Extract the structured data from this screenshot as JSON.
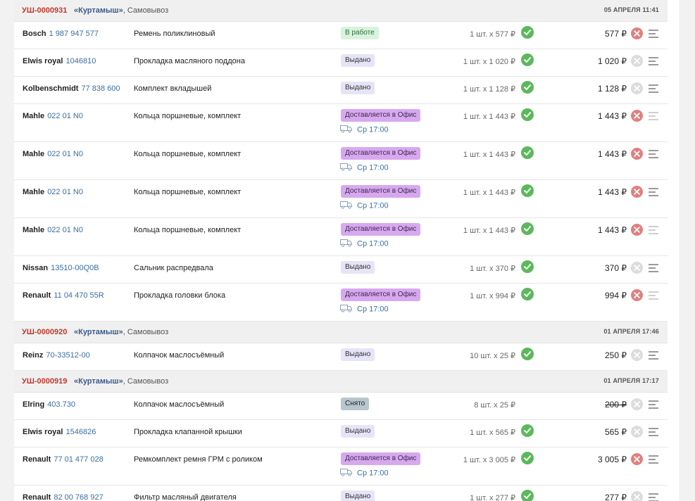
{
  "currency": "₽",
  "orders": [
    {
      "number": "УШ-0000931",
      "store": "«Куртамыш»",
      "delivery": ", Самовывоз",
      "datetime": "05 АПРЕЛЯ 11:41",
      "items": [
        {
          "brand": "Bosch",
          "article": "1 987 947 577",
          "name": "Ремень поликлиновый",
          "status": "В работе",
          "status_kind": "work",
          "eta": "",
          "qty": "1 шт. х 577 ₽",
          "price": "577 ₽",
          "checked": true,
          "cancel_active": true,
          "menu_light": false
        },
        {
          "brand": "Elwis royal",
          "article": "1046810",
          "name": "Прокладка масляного поддона",
          "status": "Выдано",
          "status_kind": "issued",
          "eta": "",
          "qty": "1 шт. х 1 020 ₽",
          "price": "1 020 ₽",
          "checked": true,
          "cancel_active": false,
          "menu_light": false
        },
        {
          "brand": "Kolbenschmidt",
          "article": "77 838 600",
          "name": "Комплект вкладышей",
          "status": "Выдано",
          "status_kind": "issued",
          "eta": "",
          "qty": "1 шт. х 1 128 ₽",
          "price": "1 128 ₽",
          "checked": true,
          "cancel_active": false,
          "menu_light": false
        },
        {
          "brand": "Mahle",
          "article": "022 01 N0",
          "name": "Кольца поршневые, комплект",
          "status": "Доставляется в Офис",
          "status_kind": "delivery",
          "eta": "Ср 17:00",
          "qty": "1 шт. х 1 443 ₽",
          "price": "1 443 ₽",
          "checked": true,
          "cancel_active": true,
          "menu_light": true
        },
        {
          "brand": "Mahle",
          "article": "022 01 N0",
          "name": "Кольца поршневые, комплект",
          "status": "Доставляется в Офис",
          "status_kind": "delivery",
          "eta": "Ср 17:00",
          "qty": "1 шт. х 1 443 ₽",
          "price": "1 443 ₽",
          "checked": true,
          "cancel_active": true,
          "menu_light": false
        },
        {
          "brand": "Mahle",
          "article": "022 01 N0",
          "name": "Кольца поршневые, комплект",
          "status": "Доставляется в Офис",
          "status_kind": "delivery",
          "eta": "Ср 17:00",
          "qty": "1 шт. х 1 443 ₽",
          "price": "1 443 ₽",
          "checked": true,
          "cancel_active": true,
          "menu_light": false
        },
        {
          "brand": "Mahle",
          "article": "022 01 N0",
          "name": "Кольца поршневые, комплект",
          "status": "Доставляется в Офис",
          "status_kind": "delivery",
          "eta": "Ср 17:00",
          "qty": "1 шт. х 1 443 ₽",
          "price": "1 443 ₽",
          "checked": true,
          "cancel_active": true,
          "menu_light": true
        },
        {
          "brand": "Nissan",
          "article": "13510-00Q0B",
          "name": "Сальник распредвала",
          "status": "Выдано",
          "status_kind": "issued",
          "eta": "",
          "qty": "1 шт. х 370 ₽",
          "price": "370 ₽",
          "checked": true,
          "cancel_active": false,
          "menu_light": false
        },
        {
          "brand": "Renault",
          "article": "11 04 470 55R",
          "name": "Прокладка головки блока",
          "status": "Доставляется в Офис",
          "status_kind": "delivery",
          "eta": "Ср 17:00",
          "qty": "1 шт. х 994 ₽",
          "price": "994 ₽",
          "checked": true,
          "cancel_active": true,
          "menu_light": true
        }
      ]
    },
    {
      "number": "УШ-0000920",
      "store": "«Куртамыш»",
      "delivery": ", Самовывоз",
      "datetime": "01 АПРЕЛЯ 17:46",
      "items": [
        {
          "brand": "Reinz",
          "article": "70-33512-00",
          "name": "Колпачок маслосъёмный",
          "status": "Выдано",
          "status_kind": "issued",
          "eta": "",
          "qty": "10 шт. х 25 ₽",
          "price": "250 ₽",
          "checked": true,
          "cancel_active": false,
          "menu_light": false
        }
      ]
    },
    {
      "number": "УШ-0000919",
      "store": "«Куртамыш»",
      "delivery": ", Самовывоз",
      "datetime": "01 АПРЕЛЯ 17:17",
      "items": [
        {
          "brand": "Elring",
          "article": "403.730",
          "name": "Колпачок маслосъёмный",
          "status": "Снято",
          "status_kind": "removed",
          "eta": "",
          "qty": "8 шт. х 25 ₽",
          "price": "200 ₽",
          "price_strike": true,
          "checked": false,
          "cancel_active": false,
          "menu_light": false
        },
        {
          "brand": "Elwis royal",
          "article": "1546826",
          "name": "Прокладка клапанной крышки",
          "status": "Выдано",
          "status_kind": "issued",
          "eta": "",
          "qty": "1 шт. х 565 ₽",
          "price": "565 ₽",
          "checked": true,
          "cancel_active": false,
          "menu_light": false
        },
        {
          "brand": "Renault",
          "article": "77 01 477 028",
          "name": "Ремкомплект ремня ГРМ с роликом",
          "status": "Доставляется в Офис",
          "status_kind": "delivery",
          "eta": "Ср 17:00",
          "qty": "1 шт. х 3 005 ₽",
          "price": "3 005 ₽",
          "checked": true,
          "cancel_active": true,
          "menu_light": false
        },
        {
          "brand": "Renault",
          "article": "82 00 768 927",
          "name": "Фильтр масляный двигателя",
          "status": "Выдано",
          "status_kind": "issued",
          "eta": "",
          "qty": "1 шт. х 277 ₽",
          "price": "277 ₽",
          "checked": true,
          "cancel_active": false,
          "menu_light": false
        }
      ]
    }
  ]
}
